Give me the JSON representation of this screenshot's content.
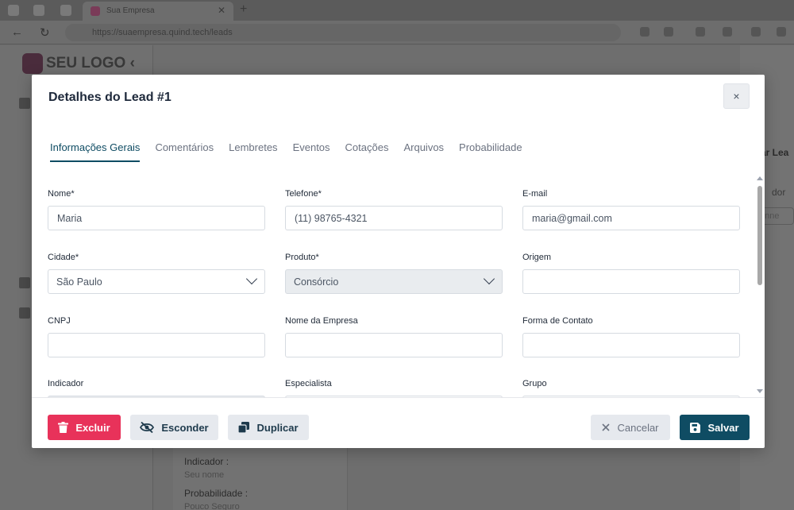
{
  "browser": {
    "tab_title": "Sua Empresa",
    "url": "https://suaempresa.quind.tech/leads"
  },
  "background_app": {
    "logo_text": "SEU LOGO",
    "right_panel_title": "tar Lea",
    "right_panel_label": "dor",
    "right_panel_placeholder": "onne",
    "lower_card": {
      "indicador_label": "Indicador :",
      "indicador_value": "Seu nome",
      "probabilidade_label": "Probabilidade :",
      "probabilidade_value": "Pouco Seguro"
    }
  },
  "modal": {
    "title": "Detalhes do Lead #1",
    "close_label": "×",
    "tabs": [
      {
        "label": "Informações Gerais",
        "active": true
      },
      {
        "label": "Comentários",
        "active": false
      },
      {
        "label": "Lembretes",
        "active": false
      },
      {
        "label": "Eventos",
        "active": false
      },
      {
        "label": "Cotações",
        "active": false
      },
      {
        "label": "Arquivos",
        "active": false
      },
      {
        "label": "Probabilidade",
        "active": false
      }
    ],
    "fields": {
      "nome": {
        "label": "Nome*",
        "value": "Maria"
      },
      "telefone": {
        "label": "Telefone*",
        "value": "(11) 98765-4321"
      },
      "email": {
        "label": "E-mail",
        "value": "maria@gmail.com"
      },
      "cidade": {
        "label": "Cidade*",
        "value": "São Paulo"
      },
      "produto": {
        "label": "Produto*",
        "value": "Consórcio"
      },
      "origem": {
        "label": "Origem",
        "value": ""
      },
      "cnpj": {
        "label": "CNPJ",
        "value": ""
      },
      "nome_empresa": {
        "label": "Nome da Empresa",
        "value": ""
      },
      "forma_contato": {
        "label": "Forma de Contato",
        "value": ""
      },
      "indicador": {
        "label": "Indicador",
        "value": ""
      },
      "especialista": {
        "label": "Especialista",
        "value": ""
      },
      "grupo": {
        "label": "Grupo",
        "value": ""
      }
    },
    "footer": {
      "excluir": "Excluir",
      "esconder": "Esconder",
      "duplicar": "Duplicar",
      "cancelar": "Cancelar",
      "salvar": "Salvar"
    }
  },
  "colors": {
    "primary": "#0f4c63",
    "danger": "#e8325a",
    "overlay": "#6b6b6b"
  }
}
